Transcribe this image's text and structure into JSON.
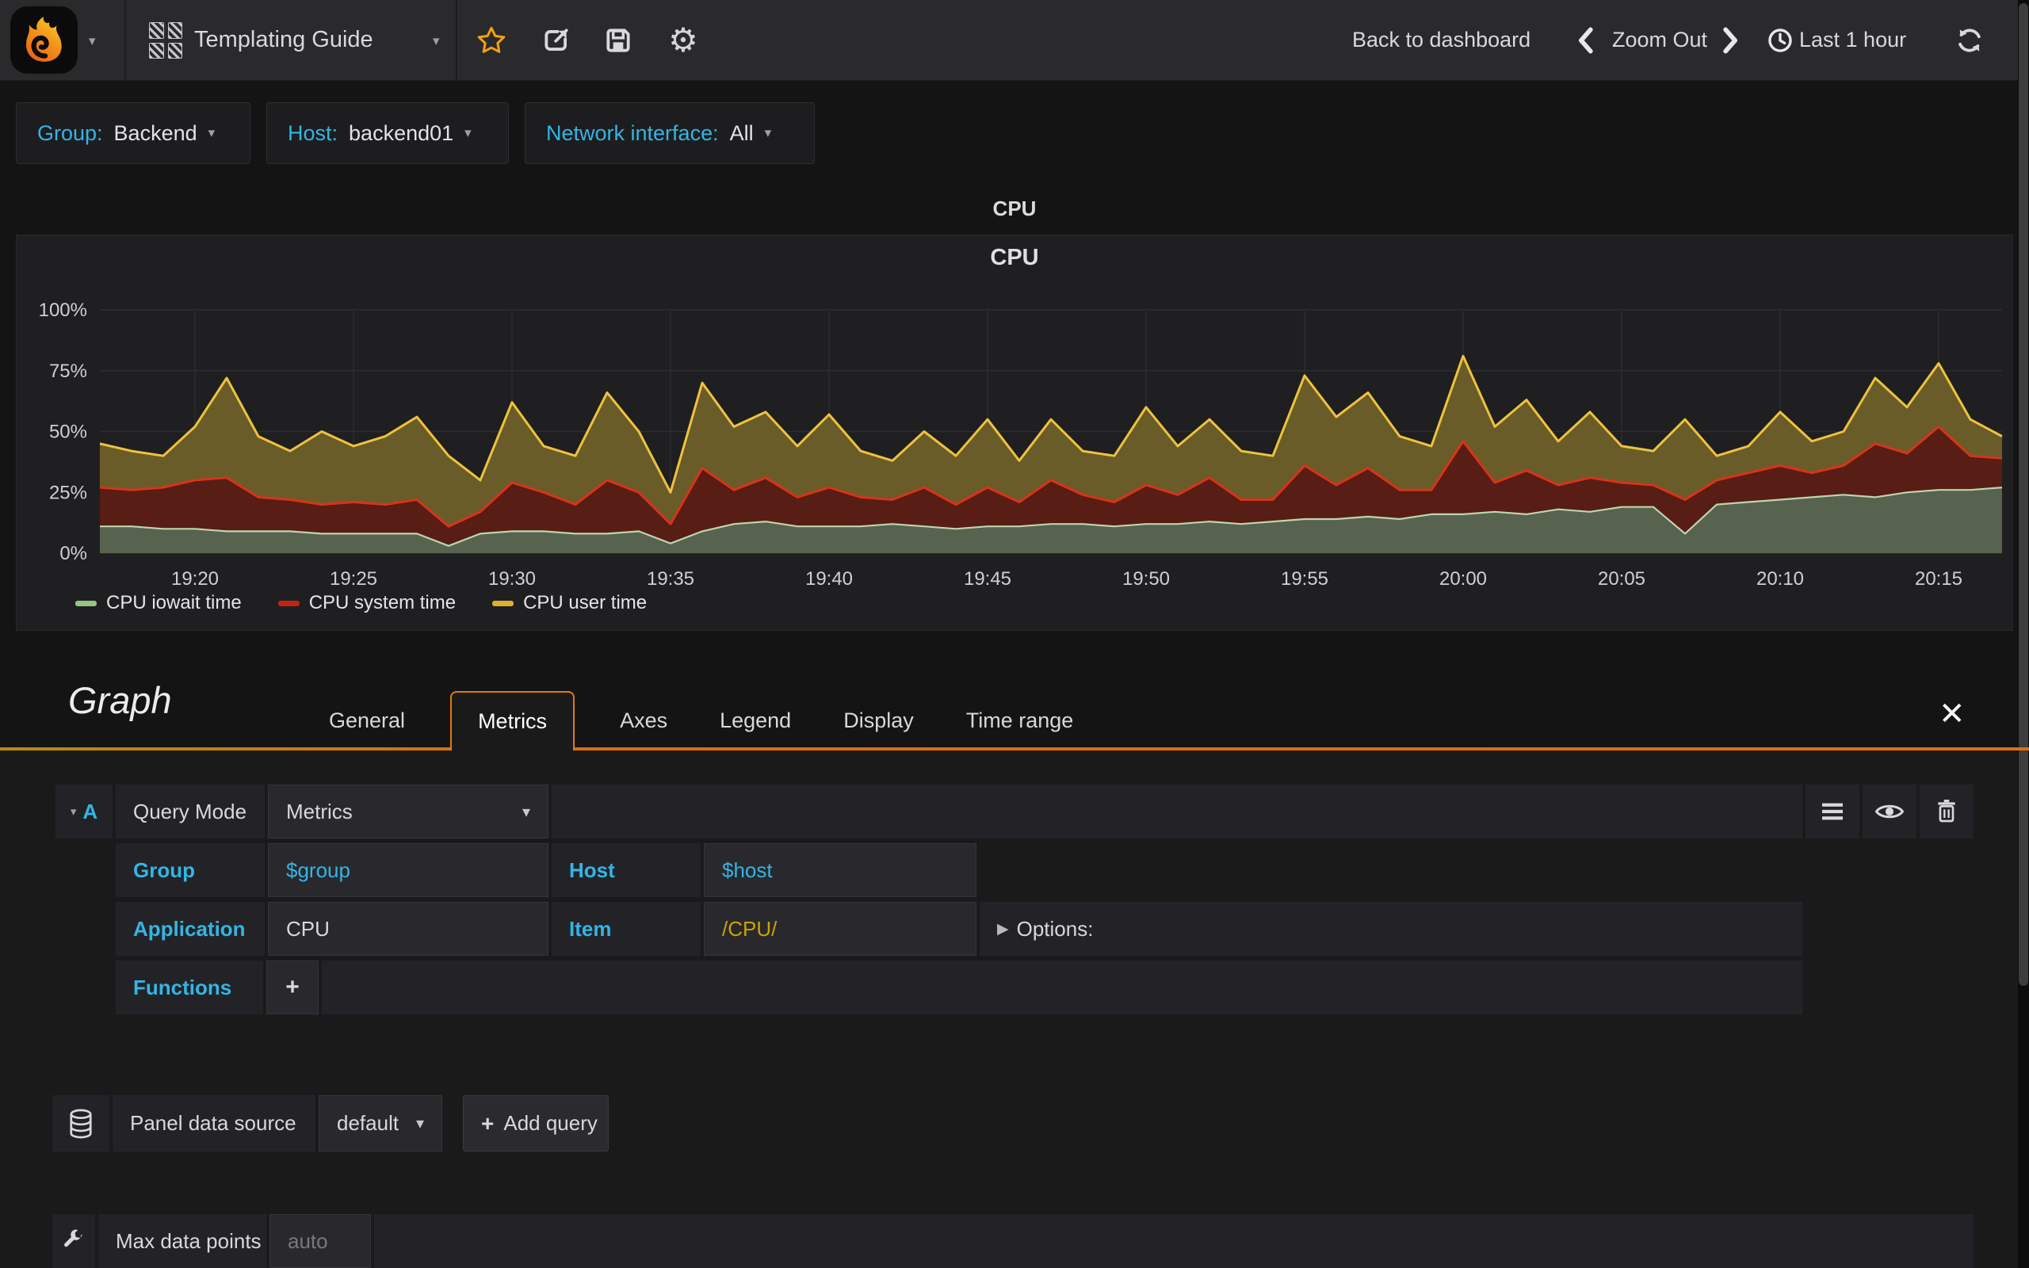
{
  "navbar": {
    "title": "Templating Guide",
    "back_to_dashboard": "Back to dashboard",
    "zoom_out": "Zoom Out",
    "time_range": "Last 1 hour"
  },
  "variables": [
    {
      "label": "Group:",
      "value": "Backend"
    },
    {
      "label": "Host:",
      "value": "backend01"
    },
    {
      "label": "Network interface:",
      "value": "All"
    }
  ],
  "panel": {
    "header_title": "CPU",
    "title": "CPU"
  },
  "editor": {
    "panel_type": "Graph",
    "tabs": [
      "General",
      "Metrics",
      "Axes",
      "Legend",
      "Display",
      "Time range"
    ],
    "active_tab": "Metrics",
    "query": {
      "ref": "A",
      "query_mode_label": "Query Mode",
      "query_mode_value": "Metrics",
      "group_label": "Group",
      "group_value": "$group",
      "host_label": "Host",
      "host_value": "$host",
      "application_label": "Application",
      "application_value": "CPU",
      "item_label": "Item",
      "item_value": "/CPU/",
      "options_label": "Options:",
      "functions_label": "Functions",
      "add_function_label": "+"
    },
    "datasource": {
      "label": "Panel data source",
      "value": "default",
      "add_query_label": "Add query",
      "add_query_plus": "+"
    },
    "max_data_points": {
      "label": "Max data points",
      "placeholder": "auto"
    }
  },
  "colors": {
    "accent_blue": "#33b5e5",
    "accent_orange": "#e07c0e",
    "star_orange": "#f2a20d",
    "item_gold": "#cca300"
  },
  "chart_data": {
    "type": "area",
    "stacked": true,
    "title": "CPU",
    "ylim": [
      0,
      100
    ],
    "yticks": [
      "0%",
      "25%",
      "50%",
      "75%",
      "100%"
    ],
    "ytick_values": [
      0,
      25,
      50,
      75,
      100
    ],
    "x_start": "19:17",
    "x_end": "20:17",
    "minutes_span": 60,
    "x_tick_minutes": [
      3,
      8,
      13,
      18,
      23,
      28,
      33,
      38,
      43,
      48,
      53,
      58
    ],
    "x_tick_labels": [
      "19:20",
      "19:25",
      "19:30",
      "19:35",
      "19:40",
      "19:45",
      "19:50",
      "19:55",
      "20:00",
      "20:05",
      "20:10",
      "20:15"
    ],
    "grid": true,
    "legend_position": "bottom-left",
    "series": [
      {
        "name": "CPU iowait time",
        "stroke": "#bdd5af",
        "fill": "#57624f",
        "legend_color": "#94c57f",
        "values": [
          11,
          11,
          10,
          10,
          9,
          9,
          9,
          8,
          8,
          8,
          8,
          3,
          8,
          9,
          9,
          8,
          8,
          9,
          4,
          9,
          12,
          13,
          11,
          11,
          11,
          12,
          11,
          10,
          11,
          11,
          12,
          12,
          11,
          12,
          12,
          13,
          12,
          13,
          14,
          14,
          15,
          14,
          16,
          16,
          17,
          16,
          18,
          17,
          19,
          19,
          8,
          20,
          21,
          22,
          23,
          24,
          23,
          25,
          26,
          26,
          27
        ]
      },
      {
        "name": "CPU system time",
        "stroke": "#da321b",
        "fill": "#581d14",
        "legend_color": "#c22412",
        "values": [
          16,
          15,
          17,
          20,
          22,
          14,
          13,
          12,
          13,
          12,
          14,
          8,
          9,
          20,
          16,
          12,
          22,
          16,
          8,
          26,
          14,
          18,
          12,
          16,
          12,
          10,
          16,
          10,
          16,
          10,
          18,
          12,
          10,
          16,
          12,
          18,
          10,
          9,
          22,
          14,
          20,
          12,
          10,
          30,
          12,
          18,
          10,
          14,
          10,
          9,
          14,
          10,
          12,
          14,
          10,
          12,
          22,
          16,
          26,
          14,
          12
        ]
      },
      {
        "name": "CPU user time",
        "stroke": "#efc23e",
        "fill": "#6a5c28",
        "legend_color": "#ddaf2e",
        "values": [
          18,
          16,
          13,
          22,
          41,
          25,
          20,
          30,
          23,
          28,
          34,
          29,
          13,
          33,
          19,
          20,
          36,
          25,
          13,
          35,
          26,
          27,
          21,
          30,
          19,
          16,
          23,
          20,
          28,
          17,
          25,
          18,
          19,
          32,
          20,
          24,
          20,
          18,
          37,
          28,
          31,
          22,
          18,
          35,
          23,
          29,
          18,
          27,
          15,
          14,
          33,
          10,
          11,
          22,
          13,
          14,
          27,
          19,
          26,
          15,
          9
        ]
      }
    ]
  }
}
